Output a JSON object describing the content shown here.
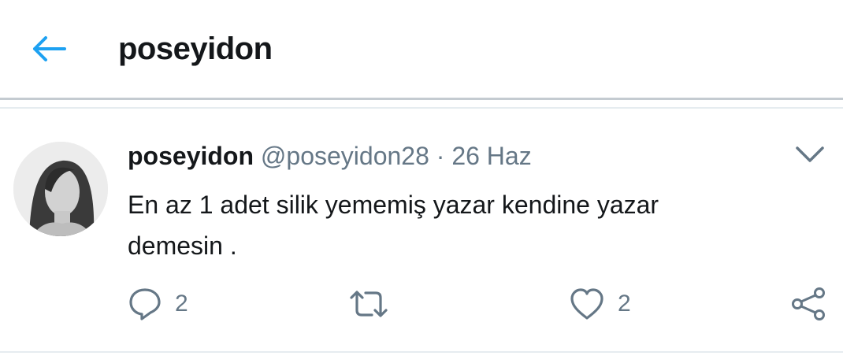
{
  "header": {
    "title": "poseyidon",
    "back_icon": "arrow-left-icon",
    "accent_color": "#1da1f2"
  },
  "tweet": {
    "author_name": "poseyidon",
    "handle": "@poseyidon28",
    "separator": "·",
    "time": "26 Haz",
    "text_line1": "En az 1 adet silik yememiş yazar kendine yazar",
    "text_line2": "demesin .",
    "menu_icon": "chevron-down-icon",
    "avatar": "avatar-photo",
    "actions": {
      "reply": {
        "icon": "reply-icon",
        "count": "2"
      },
      "retweet": {
        "icon": "retweet-icon"
      },
      "like": {
        "icon": "heart-icon",
        "count": "2"
      },
      "share": {
        "icon": "share-icon"
      }
    }
  }
}
